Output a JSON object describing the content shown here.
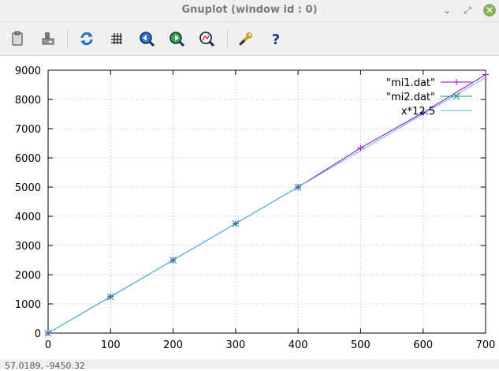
{
  "window": {
    "title": "Gnuplot (window id : 0)",
    "buttons": [
      "minimize",
      "maximize",
      "close"
    ]
  },
  "toolbar": {
    "items": [
      {
        "name": "copy-clipboard-icon"
      },
      {
        "name": "print-icon"
      },
      {
        "name": "replot-icon"
      },
      {
        "name": "grid-icon"
      },
      {
        "name": "previous-zoom-icon"
      },
      {
        "name": "next-zoom-icon"
      },
      {
        "name": "autoscale-icon"
      },
      {
        "name": "settings-icon"
      },
      {
        "name": "help-icon"
      }
    ]
  },
  "status": {
    "coords": "57.0189, -9450.32"
  },
  "colors": {
    "mi1": "#9400d3",
    "mi2": "#009e73",
    "fit": "#56b4e9"
  },
  "chart_data": {
    "type": "line",
    "title": "",
    "xlabel": "",
    "ylabel": "",
    "xlim": [
      0,
      700
    ],
    "ylim": [
      0,
      9000
    ],
    "xticks": [
      0,
      100,
      200,
      300,
      400,
      500,
      600,
      700
    ],
    "yticks": [
      0,
      1000,
      2000,
      3000,
      4000,
      5000,
      6000,
      7000,
      8000,
      9000
    ],
    "grid": true,
    "legend_position": "top-right",
    "series": [
      {
        "name": "\"mi1.dat\"",
        "x": [
          0,
          100,
          200,
          300,
          400,
          500,
          600,
          700
        ],
        "y": [
          0,
          1250,
          2500,
          3750,
          5000,
          6340,
          7550,
          8850
        ],
        "marker": "plus"
      },
      {
        "name": "\"mi2.dat\"",
        "x": [
          0,
          100,
          200,
          300,
          400
        ],
        "y": [
          0,
          1240,
          2500,
          3750,
          5000
        ],
        "marker": "cross"
      },
      {
        "name": "x*12.5",
        "function": "x*12.5",
        "x": [
          0,
          700
        ],
        "y": [
          0,
          8750
        ],
        "marker": "none"
      }
    ]
  }
}
